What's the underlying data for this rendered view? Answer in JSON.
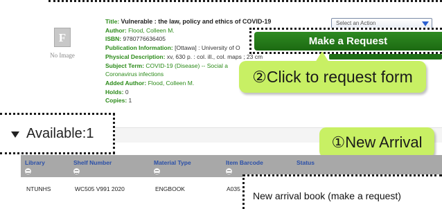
{
  "record": {
    "no_image_label": "No Image",
    "placeholder_glyph": "F",
    "fields": [
      {
        "label": "Title:",
        "value": "Vulnerable : the law, policy and ethics of COVID-19"
      },
      {
        "label": "Author:",
        "value": "Flood, Colleen M."
      },
      {
        "label": "ISBN:",
        "value": "9780776636405"
      },
      {
        "label": "Publication Information:",
        "value": "[Ottawa] : University of O"
      },
      {
        "label": "Physical Description:",
        "value": "xv, 630 p. : col. ill., col. maps ; 23 cm"
      },
      {
        "label": "Subject Term:",
        "value": "COVID-19 (Disease) -- Social a"
      },
      {
        "label": "",
        "value": "Coronavirus infections"
      },
      {
        "label": "Added Author:",
        "value": "Flood, Colleen M."
      },
      {
        "label": "Holds:",
        "value": "0"
      },
      {
        "label": "Copies:",
        "value": "1"
      }
    ],
    "action_select": {
      "selected": "Select an Action"
    },
    "make_request_label": "Make a Request"
  },
  "callouts": {
    "step2": "②Click to request form",
    "step1": "①New Arrival",
    "note": "New arrival book (make a request)"
  },
  "availability": {
    "heading": "Available:1"
  },
  "table": {
    "columns": [
      "Library",
      "Shelf Number",
      "Material Type",
      "Item Barcode",
      "Status"
    ],
    "rows": [
      [
        "NTUNHS",
        "WC505 V991 2020",
        "ENGBOOK",
        "A035",
        ""
      ]
    ]
  },
  "colors": {
    "label_green": "#2a8a18",
    "button_green": "#1c6a12",
    "callout_lime": "#c8f064",
    "header_gray": "#a8a8a8",
    "column_blue": "#2a4fa8"
  }
}
